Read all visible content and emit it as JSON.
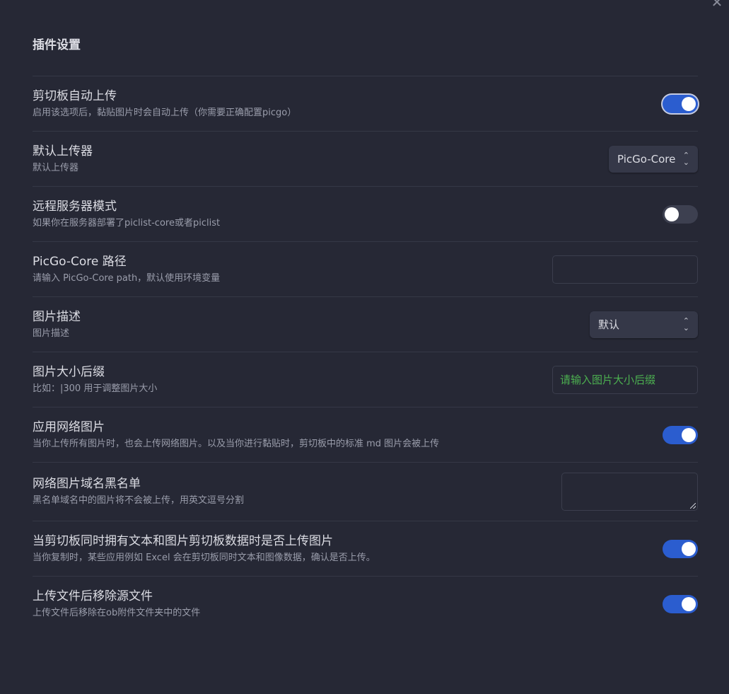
{
  "close_label": "✕",
  "section_title": "插件设置",
  "settings": [
    {
      "name": "剪切板自动上传",
      "desc": "启用该选项后，黏贴图片时会自动上传（你需要正确配置picgo）",
      "control": "toggle",
      "state": true
    },
    {
      "name": "默认上传器",
      "desc": "默认上传器",
      "control": "select",
      "value": "PicGo-Core"
    },
    {
      "name": "远程服务器模式",
      "desc": "如果你在服务器部署了piclist-core或者piclist",
      "control": "toggle",
      "state": false
    },
    {
      "name": "PicGo-Core 路径",
      "desc": "请输入 PicGo-Core path，默认使用环境变量",
      "control": "text",
      "value": "",
      "placeholder": ""
    },
    {
      "name": "图片描述",
      "desc": "图片描述",
      "control": "select",
      "value": "默认"
    },
    {
      "name": "图片大小后缀",
      "desc": "比如：|300 用于调整图片大小",
      "control": "text",
      "value": "",
      "placeholder": "请输入图片大小后缀"
    },
    {
      "name": "应用网络图片",
      "desc": "当你上传所有图片时，也会上传网络图片。以及当你进行黏贴时，剪切板中的标准 md 图片会被上传",
      "control": "toggle",
      "state": true
    },
    {
      "name": "网络图片域名黑名单",
      "desc": "黑名单域名中的图片将不会被上传，用英文逗号分割",
      "control": "textarea",
      "value": ""
    },
    {
      "name": "当剪切板同时拥有文本和图片剪切板数据时是否上传图片",
      "desc": "当你复制时，某些应用例如 Excel 会在剪切板同时文本和图像数据，确认是否上传。",
      "control": "toggle",
      "state": true
    },
    {
      "name": "上传文件后移除源文件",
      "desc": "上传文件后移除在ob附件文件夹中的文件",
      "control": "toggle",
      "state": true
    }
  ],
  "colors": {
    "background": "#262835",
    "toggle_on": "#2b5dcf",
    "toggle_off": "#3d4050",
    "placeholder": "#4caf50"
  },
  "icons": {
    "close": "close-icon",
    "select_chevron": "chevron-up-down-icon",
    "resize": "resize-grip-icon"
  }
}
